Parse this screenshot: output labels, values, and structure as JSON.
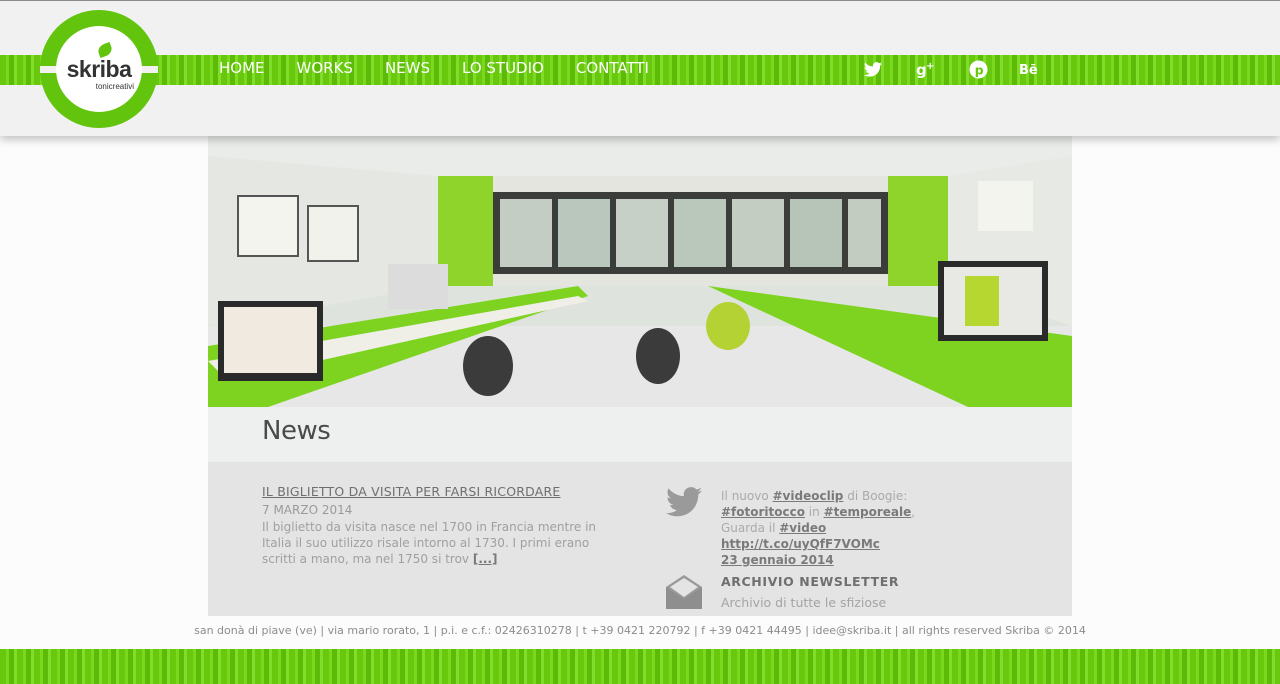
{
  "brand": {
    "name": "skriba",
    "tagline": "tonicreativi",
    "accent": "#68c80e"
  },
  "nav": {
    "items": [
      {
        "label": "HOME"
      },
      {
        "label": "WORKS"
      },
      {
        "label": "NEWS"
      },
      {
        "label": "LO STUDIO"
      },
      {
        "label": "CONTATTI"
      }
    ],
    "social": [
      "twitter-icon",
      "google-plus-icon",
      "pinterest-icon",
      "behance-icon"
    ]
  },
  "banner": {
    "icon": "office-photo"
  },
  "page": {
    "title": "News"
  },
  "post": {
    "title": "IL BIGLIETTO DA VISITA PER FARSI RICORDARE",
    "date": "7 MARZO 2014",
    "excerpt": "Il biglietto da visita nasce nel 1700 in Francia mentre in Italia il suo utilizzo risale intorno al 1730. I primi erano scritti a mano, ma nel 1750 si trov ",
    "more": "[...]"
  },
  "tweet": {
    "t1": "Il nuovo ",
    "h1": "#videoclip",
    "t2": " di Boogie: ",
    "h2": "#fotoritocco",
    "t3": " in ",
    "h3": "#temporeale",
    "t4": ", Guarda il ",
    "h4": "#video",
    "link": "http://t.co/uyQfF7VOMc",
    "date": "23 gennaio 2014"
  },
  "newsletter": {
    "title": "ARCHIVIO NEWSLETTER",
    "subtitle": "Archivio di tutte le sfiziose"
  },
  "footer": {
    "text": "san donà di piave (ve) | via mario rorato, 1 | p.i. e c.f.: 02426310278 | t +39 0421 220792 | f +39 0421 44495 | idee@skriba.it | all rights reserved Skriba © 2014"
  }
}
